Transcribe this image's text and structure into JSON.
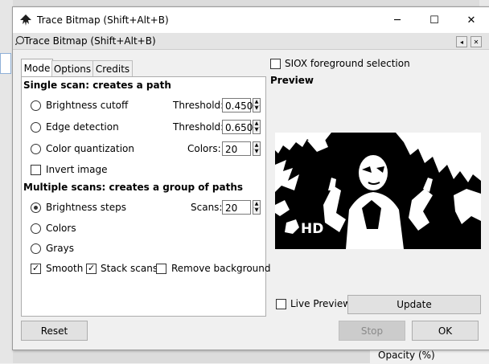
{
  "window": {
    "title": "Trace Bitmap (Shift+Alt+B)",
    "minimize_glyph": "─",
    "maximize_glyph": "☐",
    "close_glyph": "✕"
  },
  "dock": {
    "title": "Trace Bitmap (Shift+Alt+B)",
    "btn_iconify": "◂",
    "btn_close": "✕"
  },
  "tabs": [
    {
      "label": "Mode",
      "active": true
    },
    {
      "label": "Options",
      "active": false
    },
    {
      "label": "Credits",
      "active": false
    }
  ],
  "single_scan": {
    "heading": "Single scan: creates a path",
    "brightness_cutoff": {
      "label": "Brightness cutoff",
      "param_label": "Threshold:",
      "value": "0.450"
    },
    "edge_detection": {
      "label": "Edge detection",
      "param_label": "Threshold:",
      "value": "0.650"
    },
    "color_quantization": {
      "label": "Color quantization",
      "param_label": "Colors:",
      "value": "20"
    },
    "invert_image": {
      "label": "Invert image",
      "checked": false
    }
  },
  "multiple_scans": {
    "heading": "Multiple scans: creates a group of paths",
    "brightness_steps": {
      "label": "Brightness steps",
      "param_label": "Scans:",
      "value": "20",
      "selected": true
    },
    "colors": {
      "label": "Colors"
    },
    "grays": {
      "label": "Grays"
    },
    "smooth": {
      "label": "Smooth",
      "checked": true
    },
    "stack_scans": {
      "label": "Stack scans",
      "checked": true
    },
    "remove_background": {
      "label": "Remove background",
      "checked": false
    }
  },
  "siox": {
    "label": "SIOX foreground selection",
    "checked": false
  },
  "preview": {
    "heading": "Preview",
    "badge": "HD",
    "live_label": "Live Preview",
    "update_label": "Update"
  },
  "buttons": {
    "reset": "Reset",
    "stop": "Stop",
    "ok": "OK"
  },
  "background_app": {
    "opacity_label": "Opacity (%)"
  },
  "colors": {
    "panel_bg": "#f0f0f0",
    "tab_active_bg": "#ffffff",
    "border": "#adadad"
  }
}
